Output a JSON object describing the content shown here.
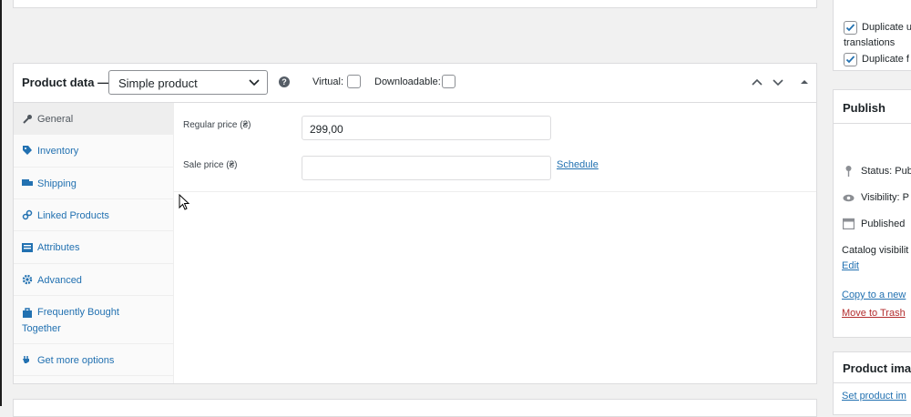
{
  "product_data": {
    "title": "Product data —",
    "product_type": "Simple product",
    "help_icon": "?",
    "virtual_label": "Virtual:",
    "downloadable_label": "Downloadable:",
    "tabs": [
      {
        "label": "General",
        "icon": "wrench-icon"
      },
      {
        "label": "Inventory",
        "icon": "tag-icon"
      },
      {
        "label": "Shipping",
        "icon": "truck-icon"
      },
      {
        "label": "Linked Products",
        "icon": "link-icon"
      },
      {
        "label": "Attributes",
        "icon": "list-icon"
      },
      {
        "label": "Advanced",
        "icon": "gear-icon"
      },
      {
        "label_line1": "Frequently Bought",
        "label_line2": "Together",
        "icon": "bag-icon"
      },
      {
        "label": "Get more options",
        "icon": "plugin-icon"
      }
    ],
    "general": {
      "regular_price_label": "Regular price (₴)",
      "regular_price_value": "299,00",
      "sale_price_label": "Sale price (₴)",
      "sale_price_value": "",
      "schedule_link": "Schedule"
    }
  },
  "languages_box": {
    "line1": "Duplicate u",
    "line2": "translations",
    "line3": "Duplicate f"
  },
  "publish": {
    "title": "Publish",
    "status": "Status: Pub",
    "visibility": "Visibility: P",
    "published": "Published",
    "catalog_visibility": "Catalog visibilit",
    "edit_link": "Edit",
    "copy_link": "Copy to a new",
    "trash_link": "Move to Trash"
  },
  "product_image": {
    "title": "Product imag",
    "set_link": "Set product im"
  }
}
